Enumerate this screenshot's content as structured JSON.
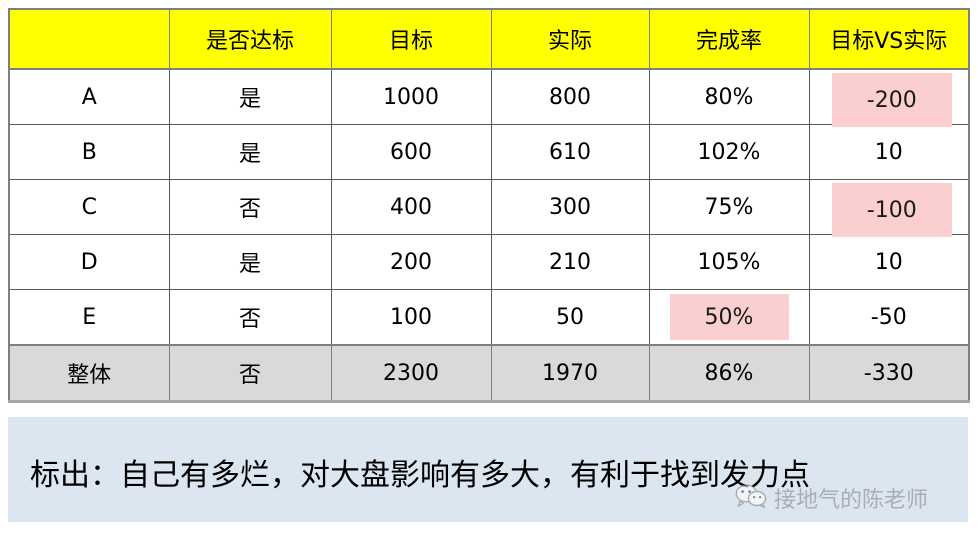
{
  "table": {
    "headers": [
      "",
      "是否达标",
      "目标",
      "实际",
      "完成率",
      "目标VS实际"
    ],
    "rows": [
      {
        "name": "A",
        "hit": "是",
        "goal": "1000",
        "actual": "800",
        "rate": "80%",
        "diff": "-200",
        "highlight": "diff"
      },
      {
        "name": "B",
        "hit": "是",
        "goal": "600",
        "actual": "610",
        "rate": "102%",
        "diff": "10",
        "highlight": ""
      },
      {
        "name": "C",
        "hit": "否",
        "goal": "400",
        "actual": "300",
        "rate": "75%",
        "diff": "-100",
        "highlight": "diff"
      },
      {
        "name": "D",
        "hit": "是",
        "goal": "200",
        "actual": "210",
        "rate": "105%",
        "diff": "10",
        "highlight": ""
      },
      {
        "name": "E",
        "hit": "否",
        "goal": "100",
        "actual": "50",
        "rate": "50%",
        "diff": "-50",
        "highlight": "rate"
      }
    ],
    "summary": {
      "name": "整体",
      "hit": "否",
      "goal": "2300",
      "actual": "1970",
      "rate": "86%",
      "diff": "-330"
    }
  },
  "caption": {
    "text": "标出：自己有多烂，对大盘影响有多大，有利于找到发力点"
  },
  "watermark": {
    "account": "接地气的陈老师",
    "icon": "wechat-icon"
  },
  "colors": {
    "header_bg": "#ffff00",
    "summary_bg": "#d9d9d9",
    "highlight_bg": "#fbcfcf",
    "caption_bg": "#dce6f1",
    "grid_line": "#7f7f7f",
    "text": "#000000",
    "watermark_text": "#8c8c8c"
  }
}
